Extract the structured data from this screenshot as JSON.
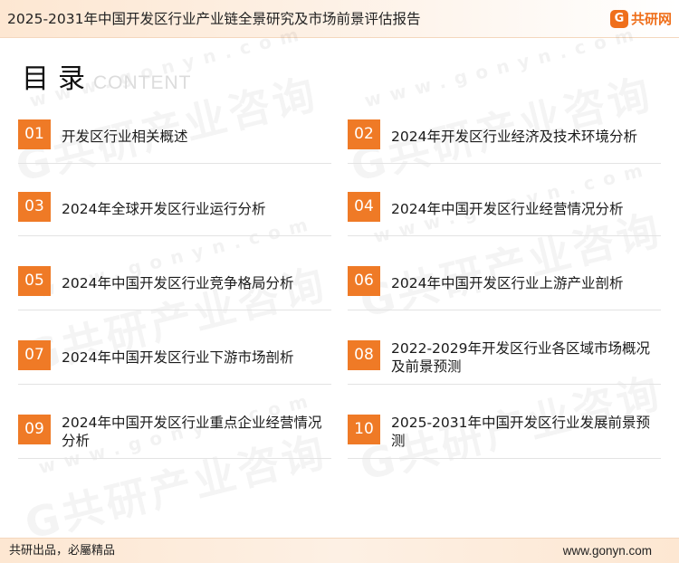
{
  "header": {
    "title": "2025-2031年中国开发区行业产业链全景研究及市场前景评估报告",
    "logo_mark": "G",
    "logo_text": "共研网"
  },
  "toc": {
    "heading": "目录",
    "sub": "CONTENT"
  },
  "items": [
    {
      "num": "01",
      "label": "开发区行业相关概述"
    },
    {
      "num": "02",
      "label": "2024年开发区行业经济及技术环境分析"
    },
    {
      "num": "03",
      "label": "2024年全球开发区行业运行分析"
    },
    {
      "num": "04",
      "label": "2024年中国开发区行业经营情况分析"
    },
    {
      "num": "05",
      "label": "2024年中国开发区行业竞争格局分析"
    },
    {
      "num": "06",
      "label": "2024年中国开发区行业上游产业剖析"
    },
    {
      "num": "07",
      "label": "2024年中国开发区行业下游市场剖析"
    },
    {
      "num": "08",
      "label": "2022-2029年开发区行业各区域市场概况及前景预测"
    },
    {
      "num": "09",
      "label": "2024年中国开发区行业重点企业经营情况分析"
    },
    {
      "num": "10",
      "label": "2025-2031年中国开发区行业发展前景预测"
    }
  ],
  "watermark": {
    "text": "G共研产业咨询",
    "url": "www.gonyn.com"
  },
  "footer": {
    "left": "共研出品，必屬精品",
    "right": "www.gonyn.com"
  }
}
